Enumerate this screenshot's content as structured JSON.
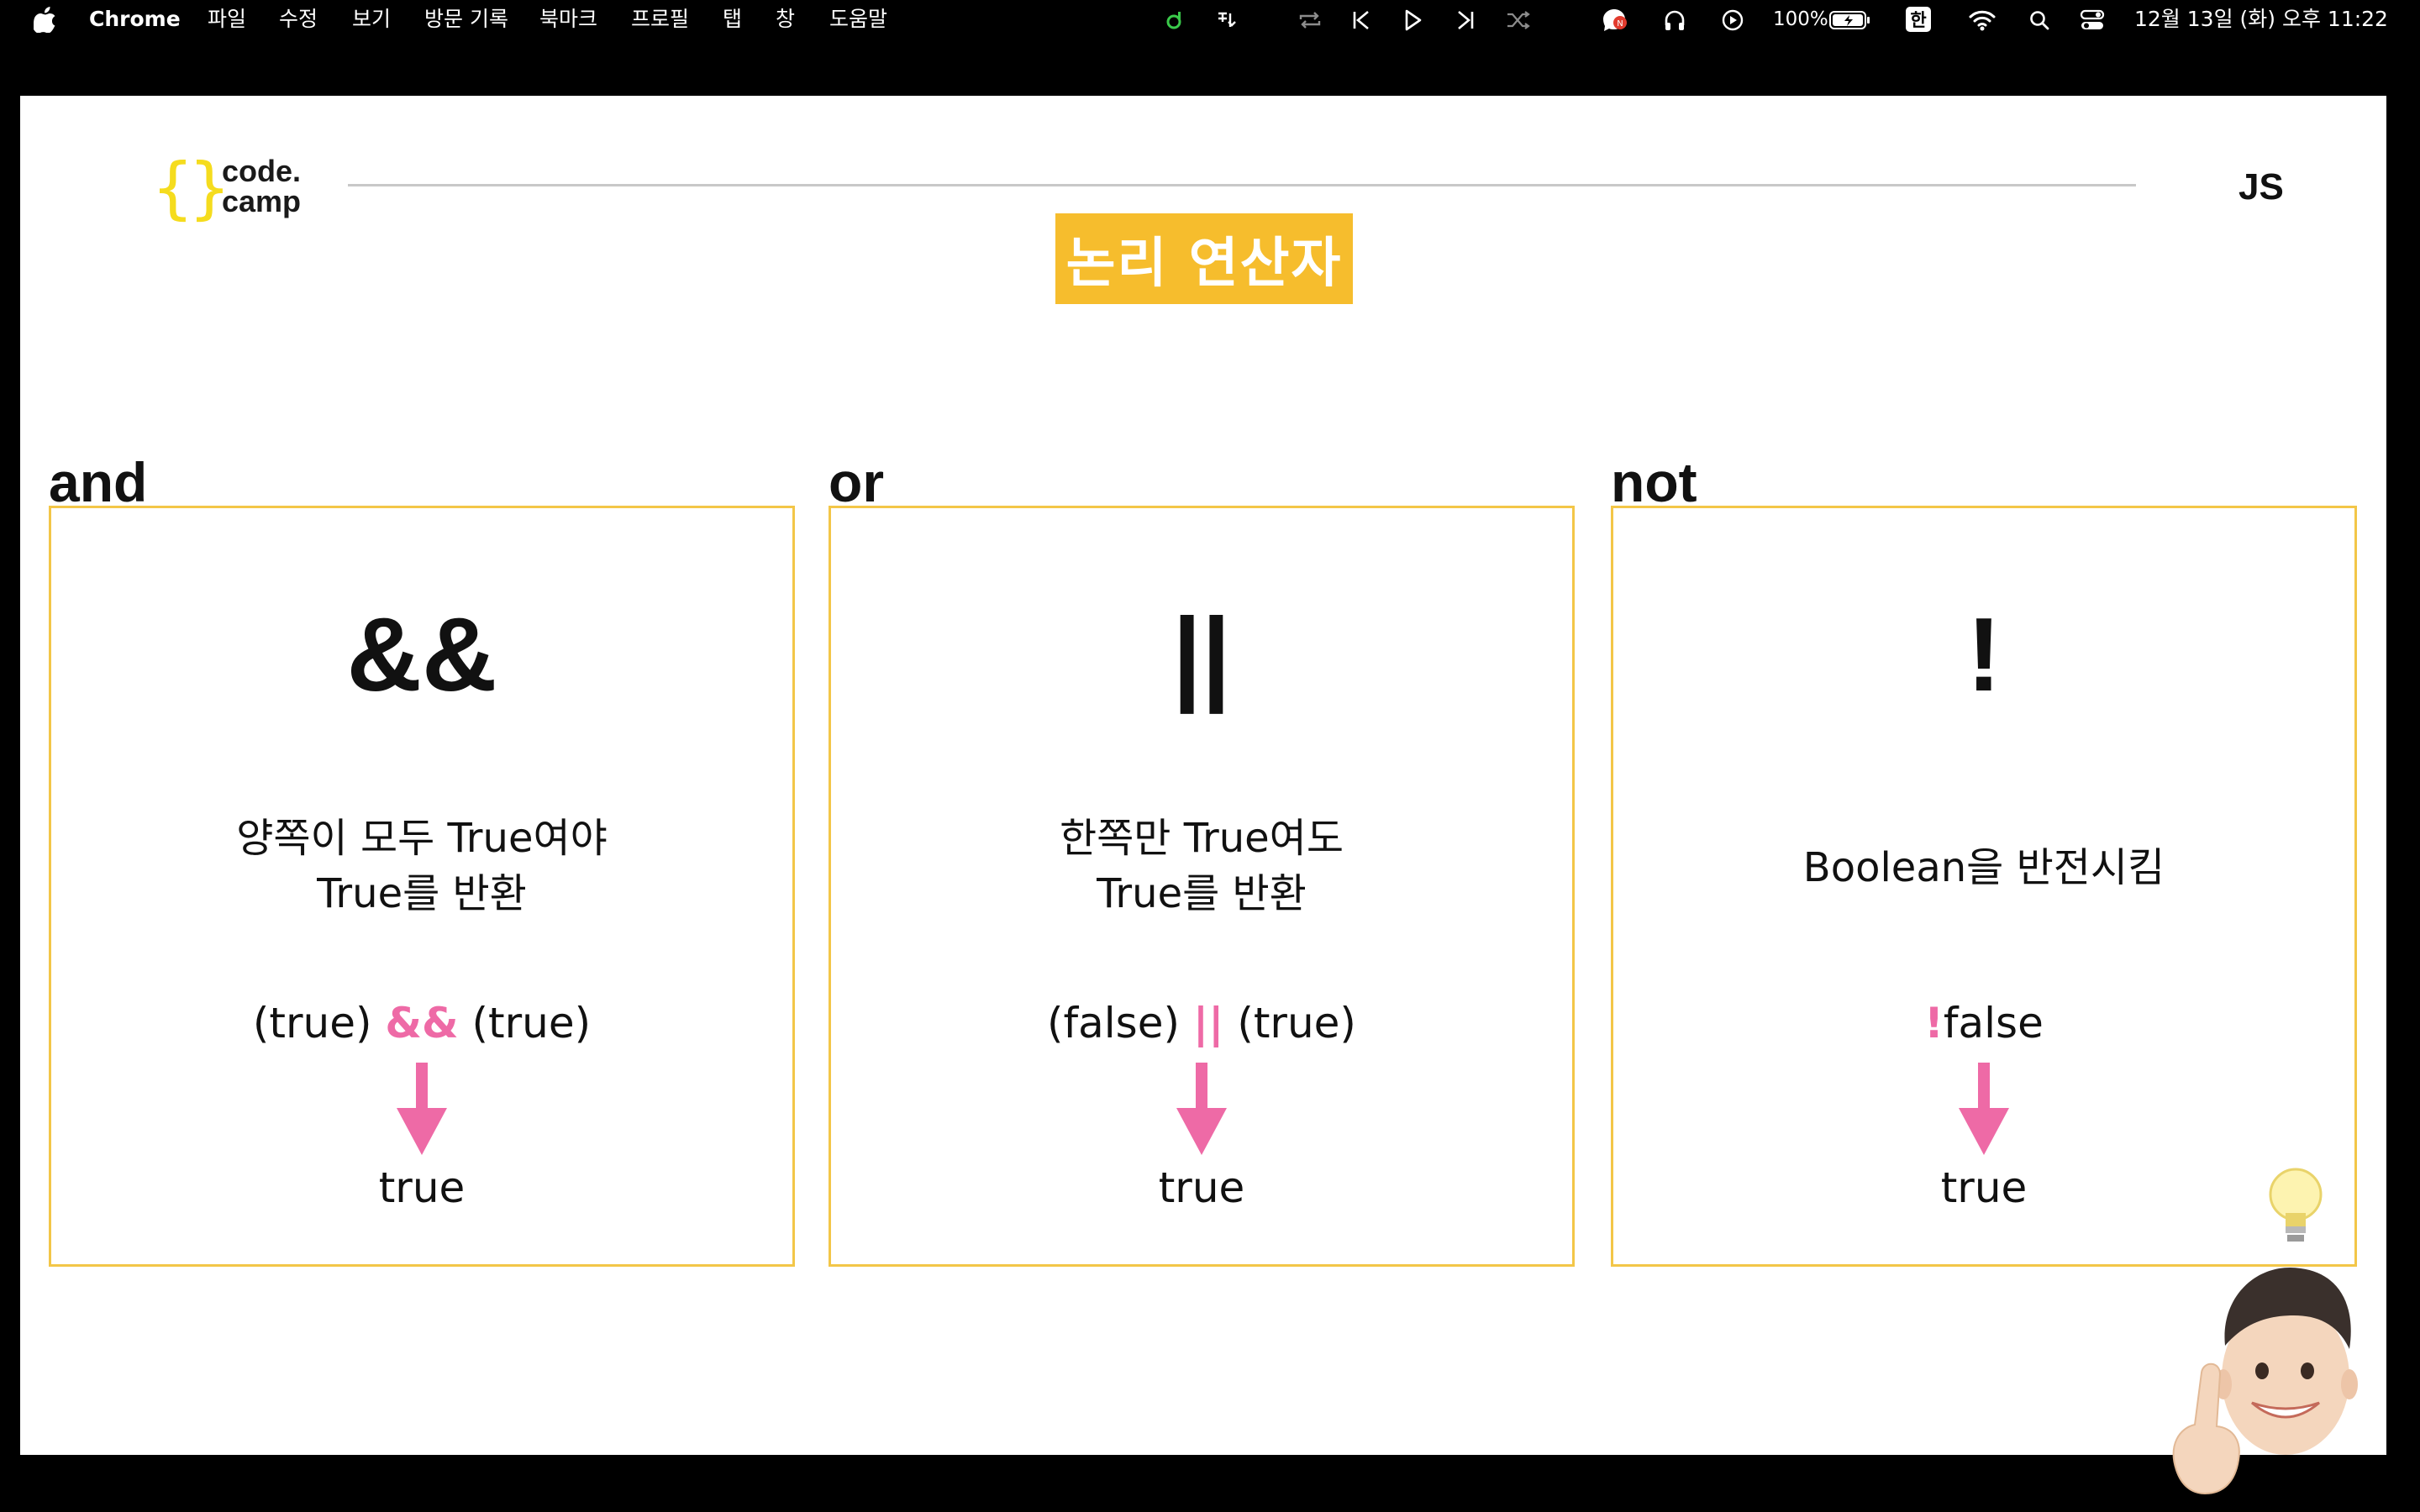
{
  "menubar": {
    "app_name": "Chrome",
    "menus": [
      "파일",
      "수정",
      "보기",
      "방문 기록",
      "북마크",
      "프로필",
      "탭",
      "창",
      "도움말"
    ],
    "status": {
      "battery": "100%",
      "input_method": "한",
      "datetime": "12월 13일 (화) 오후 11:22"
    },
    "icons": [
      "apple-icon",
      "music-icon",
      "lyrics-icon",
      "repeat-icon",
      "previous-icon",
      "play-icon",
      "next-icon",
      "shuffle-icon",
      "notification-icon",
      "headphones-icon",
      "play-circle-icon",
      "battery-icon",
      "wifi-icon",
      "search-icon",
      "control-center-icon"
    ]
  },
  "slide": {
    "logo": {
      "open_brace": "{",
      "close_brace": "}",
      "text": "code.\ncamp"
    },
    "lang_tag": "JS",
    "title": "논리 연산자",
    "accent_color": "#f6bd2d",
    "operator_color": "#ee6aa6",
    "columns": [
      {
        "label": "and",
        "symbol": "&&",
        "description": "양쪽이 모두 True여야\nTrue를 반환",
        "expression": {
          "left": "(true) ",
          "operator": "&&",
          "right": " (true)"
        },
        "result": "true"
      },
      {
        "label": "or",
        "symbol": "||",
        "description": "한쪽만 True여도\nTrue를 반환",
        "expression": {
          "left": "(false) ",
          "operator": "||",
          "right": " (true)"
        },
        "result": "true"
      },
      {
        "label": "not",
        "symbol": "!",
        "description": "Boolean을 반전시킴",
        "expression": {
          "left": "",
          "operator": "!",
          "right": "false"
        },
        "result": "true"
      }
    ]
  }
}
